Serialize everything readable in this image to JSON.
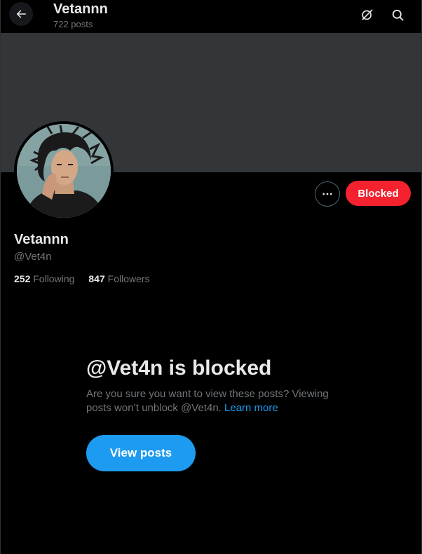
{
  "header": {
    "title": "Vetannn",
    "posts_count": "722 posts",
    "back_icon": "arrow-left-icon",
    "grok_icon": "grok-icon",
    "search_icon": "search-icon"
  },
  "banner": {
    "color": "#333639"
  },
  "profile": {
    "avatar_icon": "profile-avatar",
    "display_name": "Vetannn",
    "handle": "@Vet4n",
    "following_count": "252",
    "following_label": "Following",
    "followers_count": "847",
    "followers_label": "Followers"
  },
  "actions": {
    "more_icon": "more-horizontal-icon",
    "blocked_label": "Blocked",
    "blocked_color": "#f4212e"
  },
  "blocked_notice": {
    "title": "@Vet4n is blocked",
    "description": "Are you sure you want to view these posts? Viewing posts won’t unblock @Vet4n.",
    "learn_more": "Learn more",
    "view_posts_label": "View posts",
    "accent_color": "#1d9bf0"
  }
}
